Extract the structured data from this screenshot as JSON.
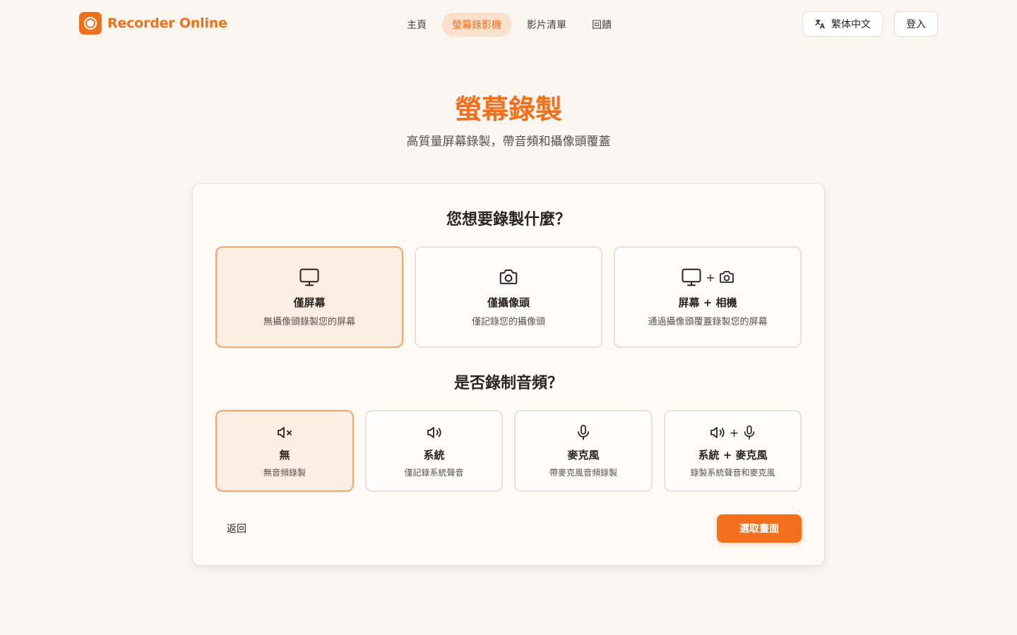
{
  "brand": {
    "name": "Recorder Online",
    "color": "#f26f1c"
  },
  "nav": {
    "items": [
      {
        "label": "主頁",
        "active": false
      },
      {
        "label": "螢幕錄影機",
        "active": true
      },
      {
        "label": "影片清單",
        "active": false
      },
      {
        "label": "回饋",
        "active": false
      }
    ]
  },
  "header": {
    "language_label": "繁体中文",
    "language_icon": "translate-icon",
    "login_label": "登入"
  },
  "hero": {
    "title": "螢幕錄製",
    "subtitle": "高質量屏幕錄製，帶音頻和攝像頭覆蓋"
  },
  "record": {
    "question": "您想要錄製什麼？",
    "options": [
      {
        "title": "僅屏幕",
        "desc": "無攝像頭錄製您的屏幕",
        "icon": "monitor-icon",
        "selected": true
      },
      {
        "title": "僅攝像頭",
        "desc": "僅記錄您的攝像頭",
        "icon": "camera-icon",
        "selected": false
      },
      {
        "title": "屏幕 + 相機",
        "desc": "通過攝像頭覆蓋錄製您的屏幕",
        "icon": "monitor-camera-icon",
        "plus": "+",
        "selected": false
      }
    ]
  },
  "audio": {
    "question": "是否錄制音頻？",
    "options": [
      {
        "title": "無",
        "desc": "無音頻錄製",
        "icon": "mute-icon",
        "selected": true
      },
      {
        "title": "系統",
        "desc": "僅記錄系統聲音",
        "icon": "speaker-icon",
        "selected": false
      },
      {
        "title": "麥克風",
        "desc": "帶麥克風音頻錄製",
        "icon": "microphone-icon",
        "selected": false
      },
      {
        "title": "系統 + 麥克風",
        "desc": "錄製系統聲音和麥克風",
        "icon": "speaker-microphone-icon",
        "plus": "+",
        "selected": false
      }
    ]
  },
  "actions": {
    "back_label": "返回",
    "primary_label": "選取畫面"
  }
}
